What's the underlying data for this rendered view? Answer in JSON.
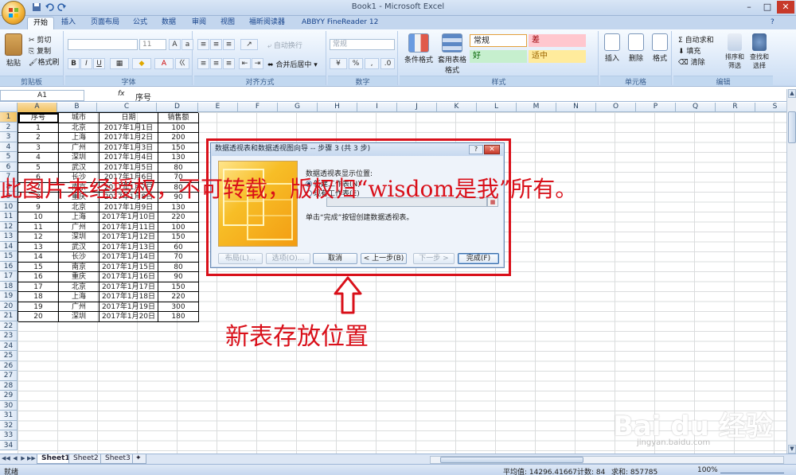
{
  "window": {
    "title": "Book1 - Microsoft Excel",
    "minimize": "–",
    "maximize": "□",
    "close": "✕"
  },
  "tabs": [
    "开始",
    "插入",
    "页面布局",
    "公式",
    "数据",
    "审阅",
    "视图",
    "福昕阅读器",
    "ABBYY FineReader 12"
  ],
  "ribbon": {
    "clipboard": {
      "label": "剪贴板",
      "paste": "粘贴",
      "cut": "剪切",
      "copy": "复制",
      "format_painter": "格式刷"
    },
    "font": {
      "label": "字体",
      "font_size": "11",
      "bold": "B",
      "italic": "I",
      "underline": "U"
    },
    "alignment": {
      "label": "对齐方式",
      "wrap": "自动换行",
      "merge": "合并后居中"
    },
    "number": {
      "label": "数字",
      "format": "常规",
      "percent": "%",
      "comma": ","
    },
    "styles": {
      "label": "样式",
      "conditional": "条件格式",
      "table": "套用表格格式",
      "normal": "常规",
      "bad": "差",
      "good": "好",
      "neutral": "适中"
    },
    "cells": {
      "label": "单元格",
      "insert": "插入",
      "delete": "删除",
      "format": "格式"
    },
    "editing": {
      "label": "编辑",
      "autosum": "自动求和",
      "fill": "填充",
      "clear": "清除",
      "sort": "排序和筛选",
      "find": "查找和选择"
    }
  },
  "formula_bar": {
    "name_box": "A1",
    "fx": "fx",
    "value": "序号"
  },
  "columns": [
    "A",
    "B",
    "C",
    "D",
    "E",
    "F",
    "G",
    "H",
    "I",
    "J",
    "K",
    "L",
    "M",
    "N",
    "O",
    "P",
    "Q",
    "R",
    "S"
  ],
  "row_numbers": [
    "1",
    "2",
    "3",
    "4",
    "5",
    "6",
    "7",
    "8",
    "9",
    "10",
    "11",
    "12",
    "13",
    "14",
    "15",
    "16",
    "17",
    "18",
    "19",
    "20",
    "21",
    "22",
    "23",
    "24",
    "25",
    "26",
    "27",
    "28",
    "29",
    "30",
    "31",
    "32",
    "33",
    "34"
  ],
  "table": {
    "headers": [
      "序号",
      "城市",
      "日期",
      "销售额"
    ],
    "rows": [
      [
        "1",
        "北京",
        "2017年1月1日",
        "100"
      ],
      [
        "2",
        "上海",
        "2017年1月2日",
        "200"
      ],
      [
        "3",
        "广州",
        "2017年1月3日",
        "150"
      ],
      [
        "4",
        "深圳",
        "2017年1月4日",
        "130"
      ],
      [
        "5",
        "武汉",
        "2017年1月5日",
        "80"
      ],
      [
        "6",
        "长沙",
        "2017年1月6日",
        "70"
      ],
      [
        "7",
        "南京",
        "2017年1月7日",
        "80"
      ],
      [
        "8",
        "重庆",
        "2017年1月8日",
        "90"
      ],
      [
        "9",
        "北京",
        "2017年1月9日",
        "130"
      ],
      [
        "10",
        "上海",
        "2017年1月10日",
        "220"
      ],
      [
        "11",
        "广州",
        "2017年1月11日",
        "100"
      ],
      [
        "12",
        "深圳",
        "2017年1月12日",
        "150"
      ],
      [
        "13",
        "武汉",
        "2017年1月13日",
        "60"
      ],
      [
        "14",
        "长沙",
        "2017年1月14日",
        "70"
      ],
      [
        "15",
        "南京",
        "2017年1月15日",
        "80"
      ],
      [
        "16",
        "重庆",
        "2017年1月16日",
        "90"
      ],
      [
        "17",
        "北京",
        "2017年1月17日",
        "150"
      ],
      [
        "18",
        "上海",
        "2017年1月18日",
        "220"
      ],
      [
        "19",
        "广州",
        "2017年1月19日",
        "300"
      ],
      [
        "20",
        "深圳",
        "2017年1月20日",
        "180"
      ]
    ]
  },
  "dialog": {
    "title": "数据透视表和数据透视图向导 -- 步骤 3 (共 3 步)",
    "help": "?",
    "close": "✕",
    "prompt": "数据透视表显示位置:",
    "option_new": "新建工作表(N)",
    "option_existing": "现有工作表(E)",
    "hint": "单击“完成”按钮创建数据透视表。",
    "buttons": {
      "layout": "布局(L)...",
      "options": "选项(O)...",
      "cancel": "取消",
      "back": "< 上一步(B)",
      "next": "下一步 >",
      "finish": "完成(F)"
    }
  },
  "sheets": [
    "Sheet1",
    "Sheet2",
    "Sheet3"
  ],
  "status": {
    "ready": "就绪",
    "average": "平均值: 14296.41667",
    "count": "计数: 84",
    "sum": "求和: 857785",
    "zoom": "100%"
  },
  "watermark": "此图片未经授权，不可转载，版权归“wisdom是我”所有。",
  "annotation": "新表存放位置",
  "baidu_logo": "Bai du 经验",
  "baidu_url": "jingyan.baidu.com",
  "colors": {
    "accent_red": "#d9101a",
    "ribbon_blue": "#c3d6ee"
  }
}
